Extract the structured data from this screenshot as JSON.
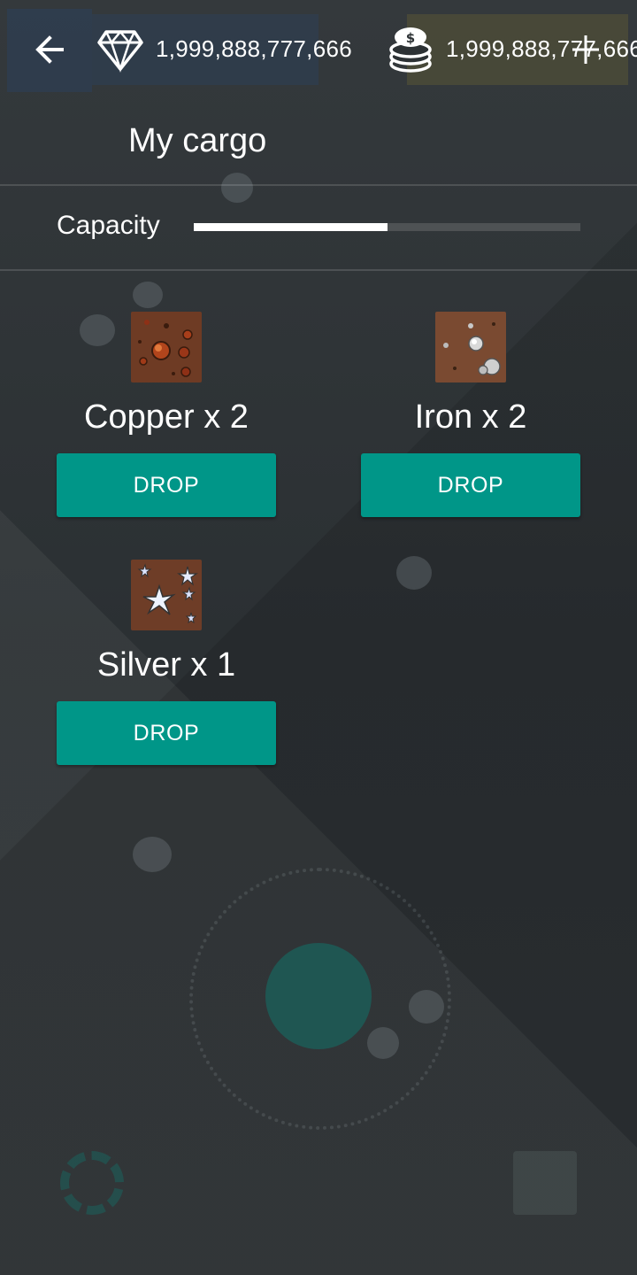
{
  "header": {
    "back_icon": "arrow-left-icon",
    "gems": {
      "icon": "diamond-icon",
      "amount": "1,999,888,777,666"
    },
    "coins": {
      "icon": "coin-stack-icon",
      "amount": "1,999,888,777,666"
    },
    "add_icon": "plus-icon"
  },
  "dialog": {
    "title": "My cargo",
    "capacity": {
      "label": "Capacity",
      "fill_fraction": 0.5
    }
  },
  "cargo_items": [
    {
      "name": "Copper x 2",
      "thumb": "copper-ore-icon",
      "drop_label": "DROP"
    },
    {
      "name": "Iron x 2",
      "thumb": "iron-ore-icon",
      "drop_label": "DROP"
    },
    {
      "name": "Silver x 1",
      "thumb": "silver-ore-icon",
      "drop_label": "DROP"
    }
  ],
  "colors": {
    "accent": "#009688",
    "overlay": "#2c3134",
    "copper_bg": "#6b3a22",
    "ore_bg": "#7a4a30"
  }
}
